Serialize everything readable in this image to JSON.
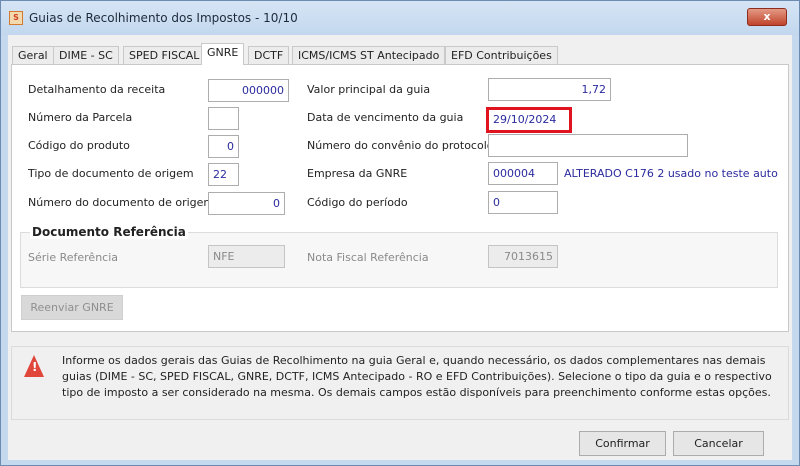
{
  "window": {
    "title": "Guias de Recolhimento dos Impostos - 10/10",
    "close": "x"
  },
  "tabs": [
    {
      "label": "Geral"
    },
    {
      "label": "DIME - SC"
    },
    {
      "label": "SPED FISCAL"
    },
    {
      "label": "GNRE",
      "active": true
    },
    {
      "label": "DCTF"
    },
    {
      "label": "ICMS/ICMS ST Antecipado"
    },
    {
      "label": "EFD Contribuições"
    }
  ],
  "form": {
    "detalhamento": {
      "label": "Detalhamento da receita",
      "value": "000000"
    },
    "parcela": {
      "label": "Número da Parcela",
      "value": ""
    },
    "produto": {
      "label": "Código do produto",
      "value": "0"
    },
    "tipo_doc": {
      "label": "Tipo de documento de origem",
      "value": "22"
    },
    "num_doc": {
      "label": "Número do documento de origem",
      "value": "0"
    },
    "valor": {
      "label": "Valor principal da guia",
      "value": "1,72"
    },
    "vencimento": {
      "label": "Data de vencimento da guia",
      "value": "29/10/2024"
    },
    "convenio": {
      "label": "Número do convênio do protocolo",
      "value": ""
    },
    "empresa": {
      "label": "Empresa da GNRE",
      "value": "000004",
      "description": "ALTERADO C176 2  usado no teste auto"
    },
    "periodo": {
      "label": "Código do período",
      "value": "0"
    }
  },
  "doc_ref": {
    "title": "Documento Referência",
    "serie": {
      "label": "Série Referência",
      "value": "NFE"
    },
    "nota": {
      "label": "Nota Fiscal Referência",
      "value": "7013615"
    }
  },
  "reenviar": "Reenviar GNRE",
  "info": "Informe os dados gerais das Guias de Recolhimento na guia Geral e, quando necessário, os dados complementares nas demais guias (DIME - SC, SPED FISCAL, GNRE, DCTF, ICMS Antecipado - RO e EFD Contribuições). Selecione o tipo da guia e o respectivo tipo de imposto a ser considerado na mesma. Os demais campos estão disponíveis para preenchimento conforme estas opções.",
  "buttons": {
    "confirm": "Confirmar",
    "cancel": "Cancelar"
  },
  "colors": {
    "highlight": "#e0141e",
    "value_text": "#2b2b9f"
  }
}
